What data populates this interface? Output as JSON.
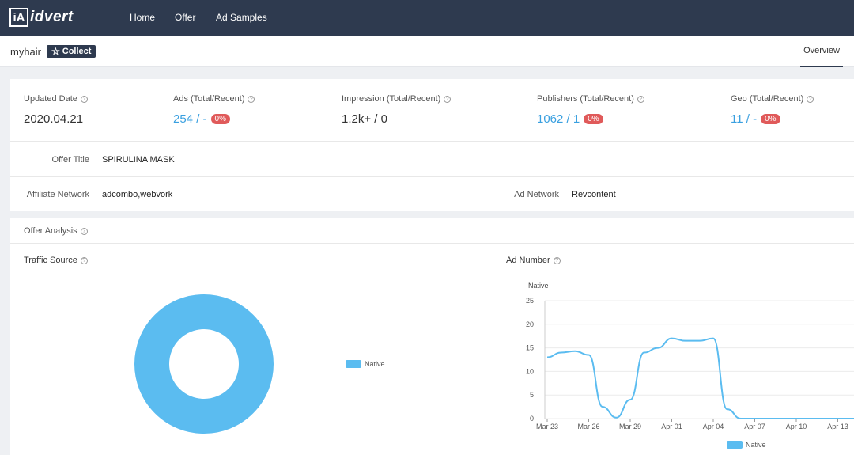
{
  "nav": {
    "logo_mark": "iA",
    "logo_text": "idvert",
    "links": [
      "Home",
      "Offer",
      "Ad Samples"
    ]
  },
  "subbar": {
    "brand": "myhair",
    "collect_label": "Collect",
    "tab_label": "Overview"
  },
  "stats": [
    {
      "label": "Updated Date",
      "value": "2020.04.21",
      "badge": ""
    },
    {
      "label": "Ads (Total/Recent)",
      "value": "254 / -",
      "badge": "0%"
    },
    {
      "label": "Impression (Total/Recent)",
      "value": "1.2k+ / 0",
      "badge": ""
    },
    {
      "label": "Publishers (Total/Recent)",
      "value": "1062 / 1",
      "badge": "0%"
    },
    {
      "label": "Geo (Total/Recent)",
      "value": "11 / -",
      "badge": "0%"
    }
  ],
  "info": {
    "offer_title_label": "Offer Title",
    "offer_title_value": "SPIRULINA MASK",
    "affiliate_label": "Affiliate Network",
    "affiliate_value": "adcombo,webvork",
    "ad_network_label": "Ad Network",
    "ad_network_value": "Revcontent"
  },
  "analysis": {
    "title": "Offer Analysis",
    "traffic_title": "Traffic Source",
    "ad_number_title": "Ad Number"
  },
  "colors": {
    "nav_bg": "#2e3a4f",
    "accent_blue": "#3aa0e0",
    "badge_red": "#e05a5a",
    "series": "#5bbcf0"
  },
  "chart_data": [
    {
      "type": "pie",
      "title": "Traffic Source",
      "donut": true,
      "series": [
        {
          "name": "Native",
          "values": [
            100
          ]
        }
      ],
      "categories": [
        "Native"
      ],
      "legend": "right"
    },
    {
      "type": "line",
      "title": "Ad Number",
      "ylabel": "Native",
      "ylim": [
        0,
        25
      ],
      "yticks": [
        0,
        5,
        10,
        15,
        20,
        25
      ],
      "xticks": [
        "Mar 23",
        "Mar 26",
        "Mar 29",
        "Apr 01",
        "Apr 04",
        "Apr 07",
        "Apr 10",
        "Apr 13"
      ],
      "series": [
        {
          "name": "Native",
          "points": [
            [
              "Mar 23",
              13
            ],
            [
              "Mar 24",
              14
            ],
            [
              "Mar 25",
              14.3
            ],
            [
              "Mar 26",
              13.5
            ],
            [
              "Mar 27",
              2.5
            ],
            [
              "Mar 28",
              0.2
            ],
            [
              "Mar 29",
              4
            ],
            [
              "Mar 30",
              14
            ],
            [
              "Mar 31",
              15
            ],
            [
              "Apr 01",
              17
            ],
            [
              "Apr 02",
              16.5
            ],
            [
              "Apr 03",
              16.5
            ],
            [
              "Apr 04",
              17
            ],
            [
              "Apr 05",
              2
            ],
            [
              "Apr 06",
              0
            ],
            [
              "Apr 07",
              0
            ],
            [
              "Apr 08",
              0
            ],
            [
              "Apr 09",
              0
            ],
            [
              "Apr 10",
              0
            ],
            [
              "Apr 11",
              0
            ],
            [
              "Apr 12",
              0
            ],
            [
              "Apr 13",
              0
            ],
            [
              "Apr 14",
              0
            ]
          ]
        }
      ],
      "legend": "bottom",
      "grid": true
    }
  ]
}
